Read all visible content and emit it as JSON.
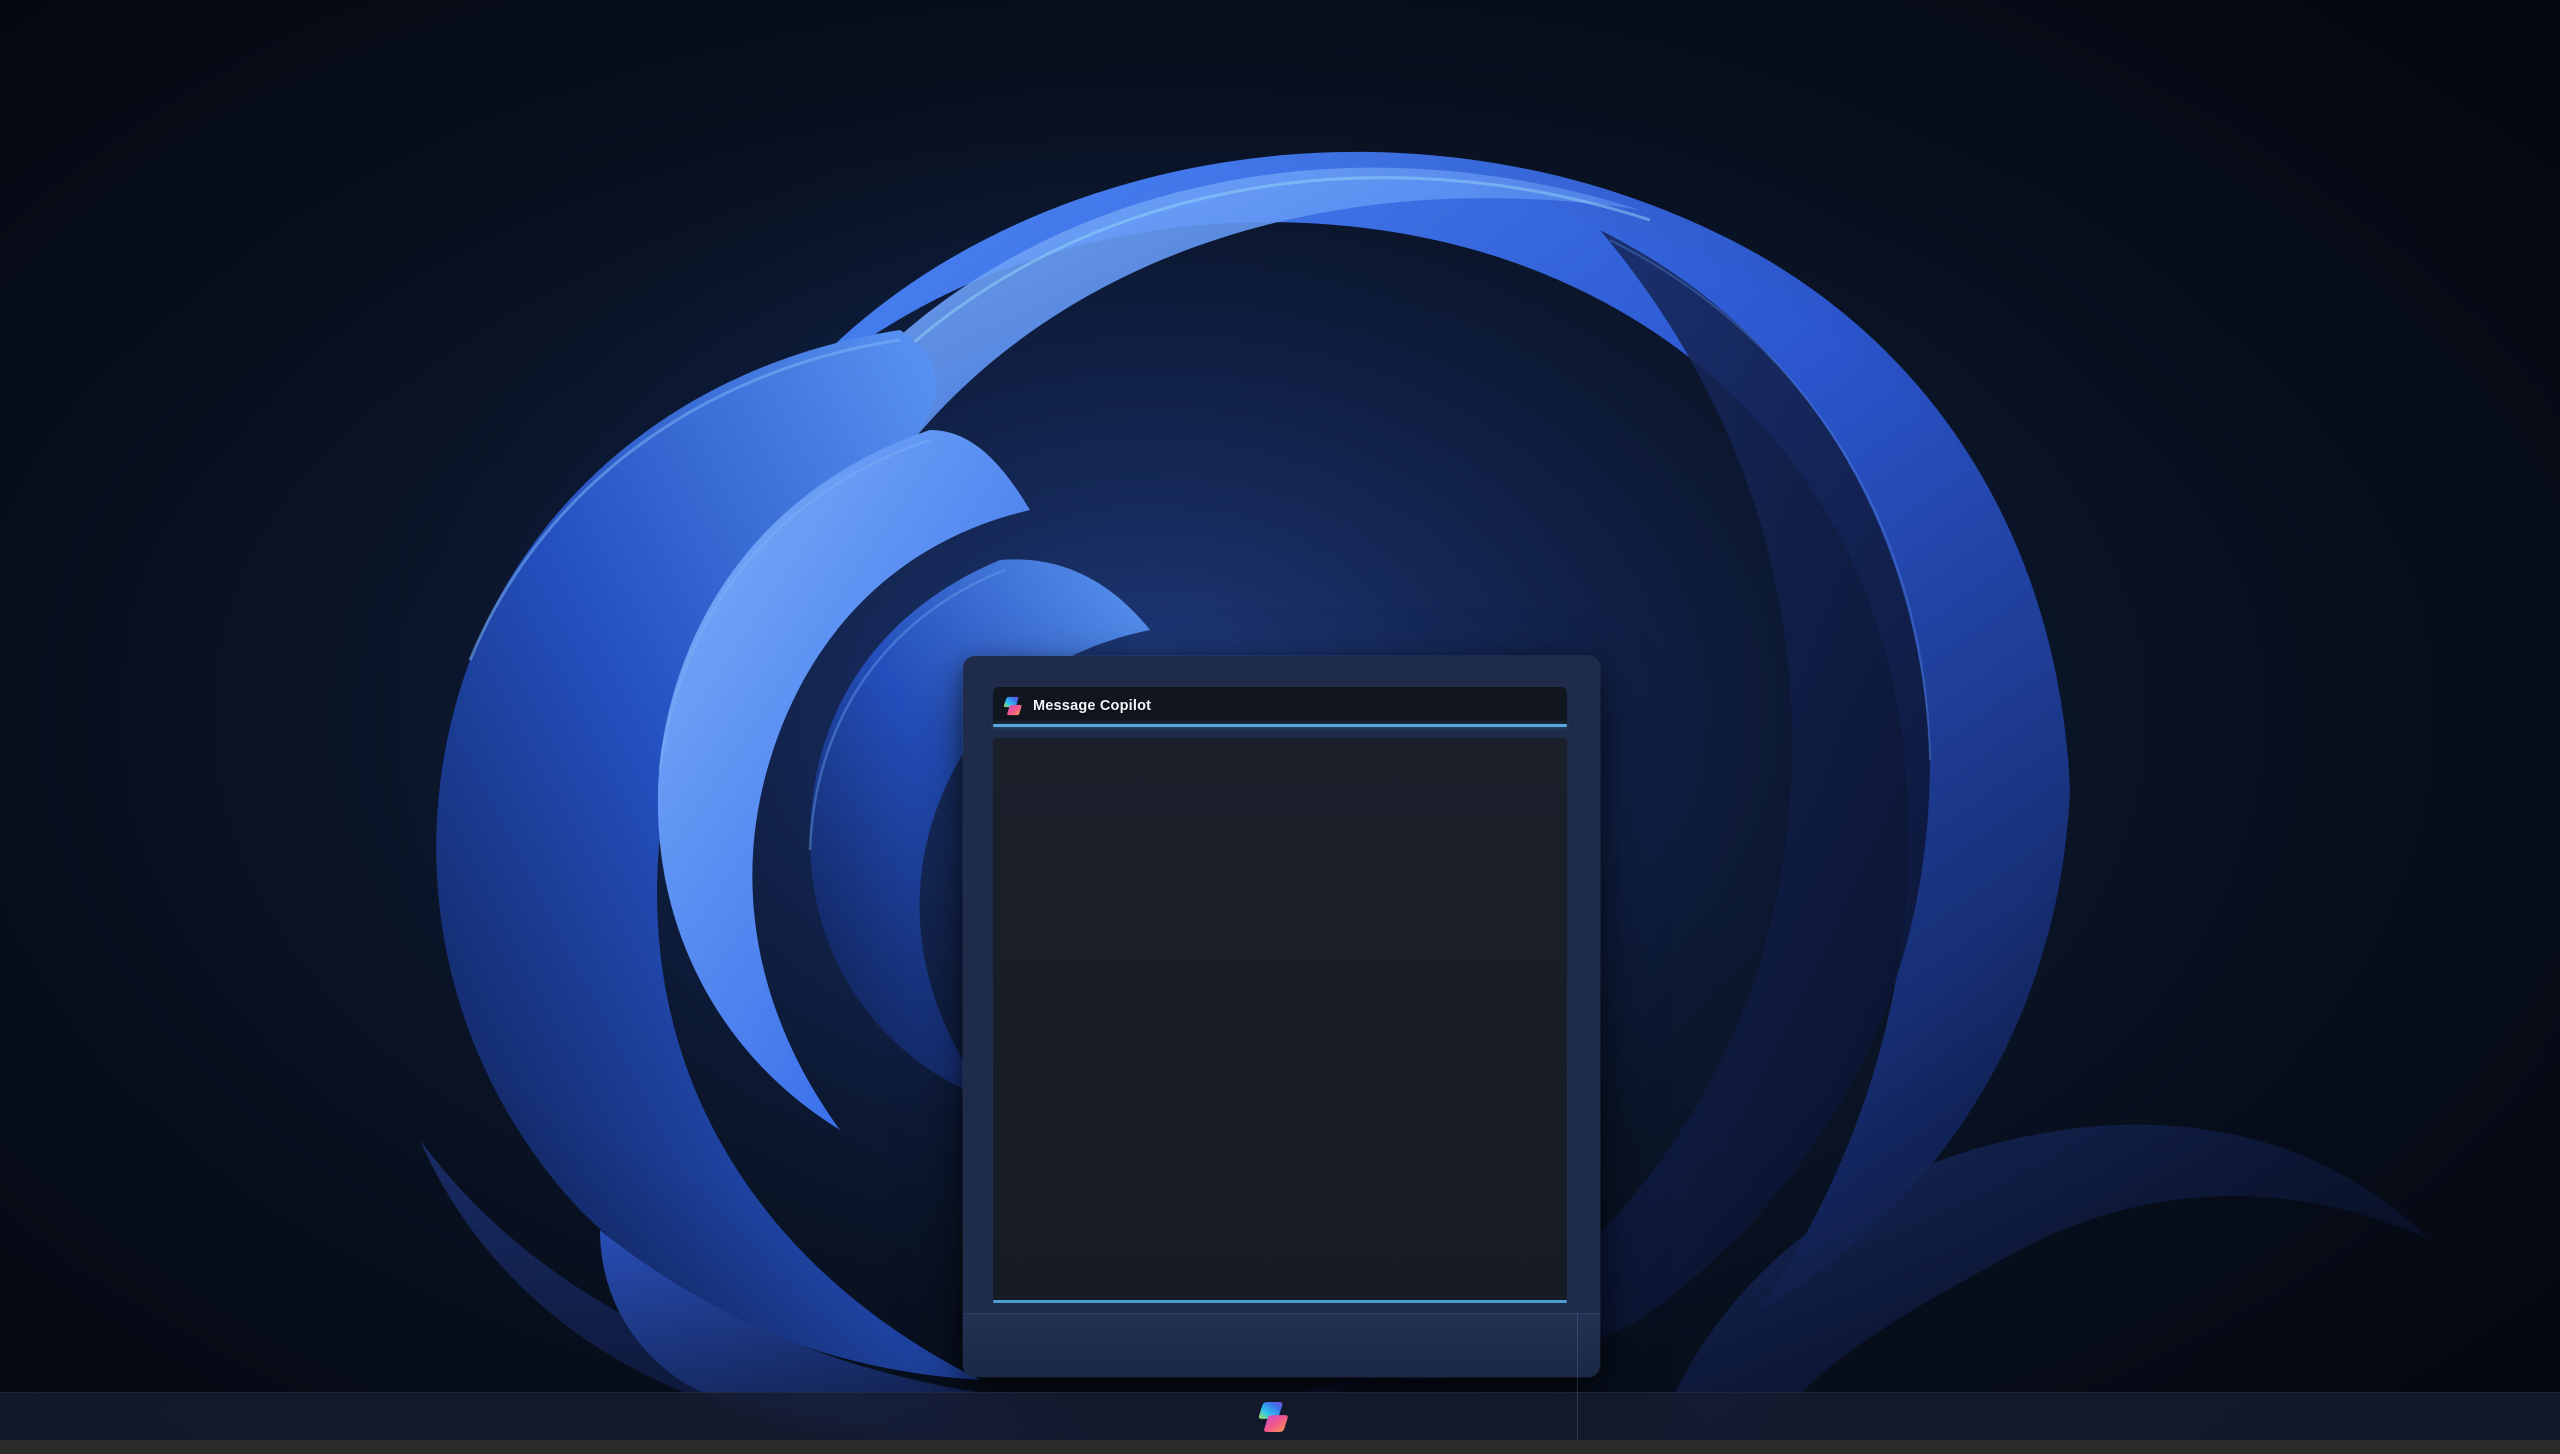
{
  "window": {
    "title": "Message Copilot",
    "icon": "copilot-logo-icon",
    "accent_color": "#55A9DF"
  },
  "taskbar": {
    "icons": [
      {
        "name": "copilot-icon"
      }
    ]
  },
  "wallpaper": {
    "name": "windows-bloom-dark",
    "base_color": "#060C18",
    "bloom_color": "#2E63E8",
    "rim_highlight_color": "#8FD0FA"
  },
  "colors": {
    "window_frame": "#1E2B49",
    "titlebar_bg": "#11151E",
    "content_bg": "#181C27",
    "titlebar_accent_line": "#55A9DF",
    "content_accent_line": "#4DA3D9",
    "bottom_panel": "#1F2E4E",
    "taskbar_bg": "#171E30",
    "bottom_strip_bg": "#2B2A28"
  }
}
